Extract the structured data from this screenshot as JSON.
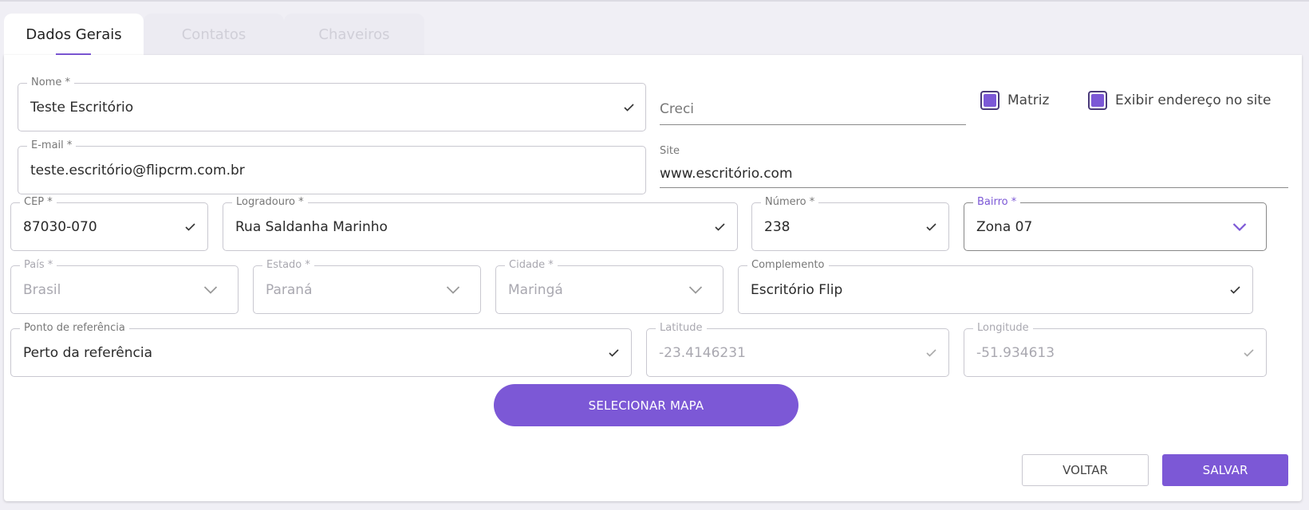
{
  "tabs": [
    {
      "label": "Dados Gerais",
      "active": true
    },
    {
      "label": "Contatos",
      "active": false
    },
    {
      "label": "Chaveiros",
      "active": false
    }
  ],
  "form": {
    "nome": {
      "label": "Nome *",
      "value": "Teste Escritório"
    },
    "email": {
      "label": "E-mail *",
      "value": "teste.escritório@flipcrm.com.br"
    },
    "creci": {
      "placeholder": "Creci"
    },
    "matriz": {
      "label": "Matriz",
      "checked": true
    },
    "exibir_endereco": {
      "label": "Exibir endereço no site",
      "checked": true
    },
    "site": {
      "label": "Site",
      "value": "www.escritório.com"
    },
    "cep": {
      "label": "CEP *",
      "value": "87030-070"
    },
    "logradouro": {
      "label": "Logradouro *",
      "value": "Rua Saldanha Marinho"
    },
    "numero": {
      "label": "Número *",
      "value": "238"
    },
    "bairro": {
      "label": "Bairro *",
      "value": "Zona 07"
    },
    "pais": {
      "label": "País *",
      "value": "Brasil"
    },
    "estado": {
      "label": "Estado *",
      "value": "Paraná"
    },
    "cidade": {
      "label": "Cidade *",
      "value": "Maringá"
    },
    "complemento": {
      "label": "Complemento",
      "value": "Escritório Flip"
    },
    "ponto_referencia": {
      "label": "Ponto de referência",
      "value": "Perto da referência"
    },
    "latitude": {
      "label": "Latitude",
      "value": "-23.4146231"
    },
    "longitude": {
      "label": "Longitude",
      "value": "-51.934613"
    }
  },
  "buttons": {
    "select_map": "SELECIONAR MAPA",
    "back": "VOLTAR",
    "save": "SALVAR"
  },
  "icons": {
    "check": "check-icon",
    "chevron": "chevron-down-icon"
  },
  "colors": {
    "accent": "#7c58d6",
    "background": "#f0eff5",
    "border": "#c9c8d0",
    "disabled_text": "#a9a8b0"
  }
}
